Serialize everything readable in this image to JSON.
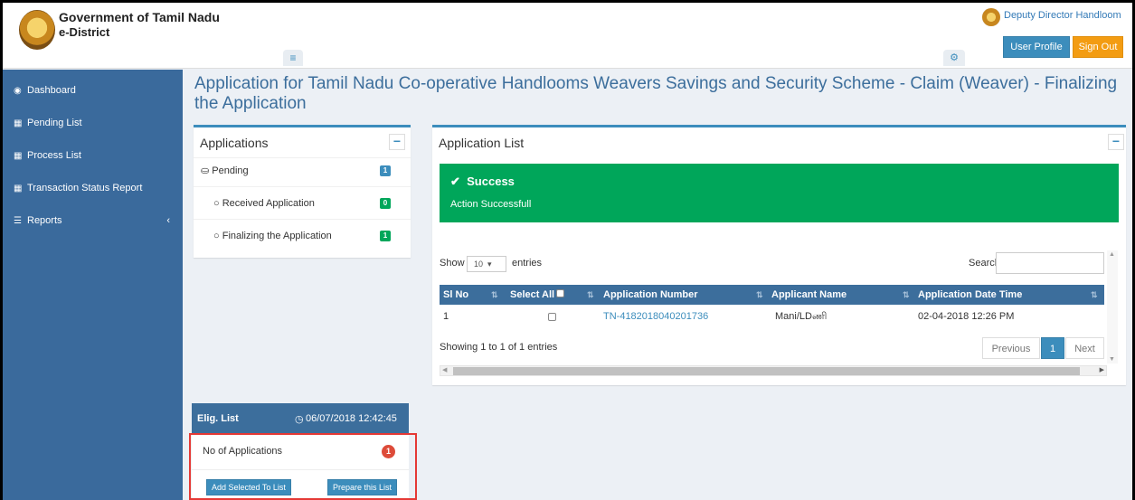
{
  "header": {
    "gov_title": "Government of Tamil Nadu",
    "gov_sub": "e-District",
    "user_name": "Deputy Director Handloom",
    "profile_label": "User Profile",
    "signout_label": "Sign Out",
    "left_toggle_icon": "bars-icon",
    "right_toggle_icon": "cogs-icon"
  },
  "sidebar": {
    "items": [
      {
        "label": "Dashboard",
        "icon": "dashboard-icon"
      },
      {
        "label": "Pending List",
        "icon": "grid-icon"
      },
      {
        "label": "Process List",
        "icon": "grid-icon"
      },
      {
        "label": "Transaction Status Report",
        "icon": "grid-icon"
      },
      {
        "label": "Reports",
        "icon": "list-icon"
      }
    ]
  },
  "page_title": "Application for Tamil Nadu Co-operative Handlooms Weavers Savings and Security Scheme - Claim (Weaver) - Finalizing the Application",
  "applications": {
    "title": "Applications",
    "pending_label": "Pending",
    "pending_count": "1",
    "received_label": "Received Application",
    "received_count": "0",
    "finalizing_label": "Finalizing the Application",
    "finalizing_count": "1"
  },
  "app_list": {
    "title": "Application List",
    "alert_title": "Success",
    "alert_text": "Action Successfull",
    "show_label": "Show",
    "entries_value": "10",
    "entries_label": "entries",
    "search_label": "Search:",
    "columns": [
      "Sl No",
      "Select All",
      "Application Number",
      "Applicant Name",
      "Application Date Time"
    ],
    "rows": [
      {
        "sl": "1",
        "number": "TN-4182018040201736",
        "name": "Mani/LDணி",
        "date": "02-04-2018 12:26 PM"
      }
    ],
    "showing": "Showing 1 to 1 of 1 entries",
    "prev": "Previous",
    "page": "1",
    "next": "Next"
  },
  "elig": {
    "title": "Elig. List",
    "datetime": "06/07/2018 12:42:45",
    "no_apps_label": "No of Applications",
    "no_apps_count": "1",
    "add_btn": "Add Selected To List",
    "prepare_btn": "Prepare this List"
  },
  "colors": {
    "sidebar": "#3a6a9c",
    "accent": "#3c8dbc",
    "success": "#00a65a",
    "warning": "#f39c12",
    "highlight": "#e53935"
  }
}
